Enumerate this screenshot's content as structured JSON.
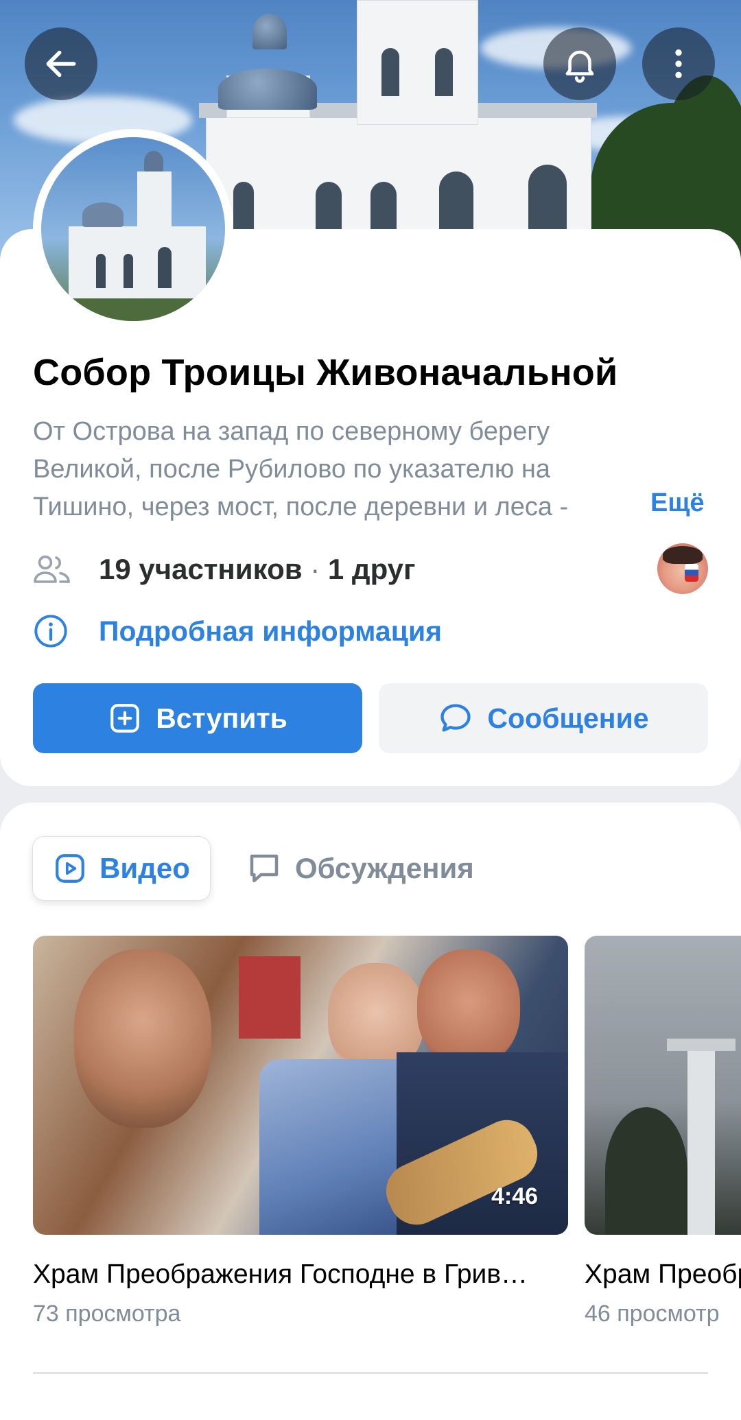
{
  "community": {
    "name": "Собор Троицы Живоначальной",
    "description": "От Острова на запад по северному берегу Великой, после Рубилово по указателю на Тишино, через мост, после деревни и леса -",
    "more_label": "Ещё",
    "members_count": "19 участников",
    "members_sep": " · ",
    "friends_count": "1 друг",
    "details_label": "Подробная информация"
  },
  "buttons": {
    "join_label": "Вступить",
    "message_label": "Сообщение"
  },
  "tabs": [
    {
      "label": "Видео",
      "icon": "play-square-icon",
      "active": true
    },
    {
      "label": "Обсуждения",
      "icon": "chat-bubble-icon",
      "active": false
    }
  ],
  "videos": [
    {
      "title": "Храм Преображения Господне в Грив…",
      "views": "73 просмотра",
      "duration": "4:46"
    },
    {
      "title": "Храм Преобр",
      "views": "46 просмотр"
    }
  ],
  "colors": {
    "accent": "#2d81e0",
    "secondary_text": "#818c99",
    "background": "#ebedf0"
  },
  "icons": [
    "back-arrow-icon",
    "bell-icon",
    "more-vertical-icon",
    "users-icon",
    "info-icon",
    "plus-square-icon",
    "message-bubble-icon"
  ]
}
